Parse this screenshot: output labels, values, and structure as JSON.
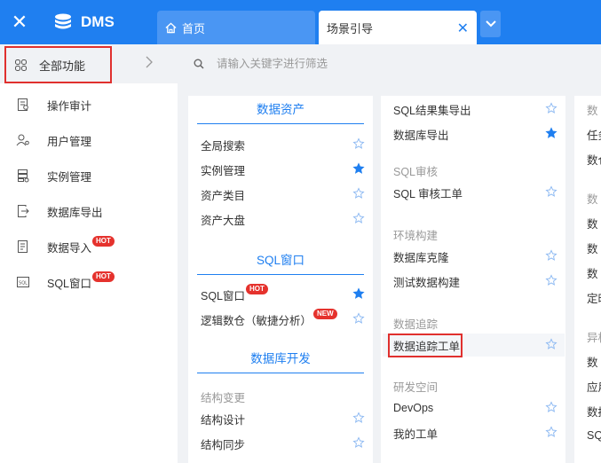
{
  "header": {
    "app_name": "DMS",
    "close_symbol": "✕",
    "tabs": [
      {
        "label": "首页"
      },
      {
        "label": "场景引导",
        "close_symbol": "✕"
      }
    ]
  },
  "sidebar": {
    "all_functions": "全部功能",
    "items": [
      {
        "label": "操作审计",
        "icon": "audit-icon"
      },
      {
        "label": "用户管理",
        "icon": "user-icon"
      },
      {
        "label": "实例管理",
        "icon": "instance-icon"
      },
      {
        "label": "数据库导出",
        "icon": "export-icon"
      },
      {
        "label": "数据导入",
        "icon": "import-icon",
        "badge": "HOT"
      },
      {
        "label": "SQL窗口",
        "icon": "sql-icon",
        "badge": "HOT"
      }
    ]
  },
  "search": {
    "placeholder": "请输入关键字进行筛选"
  },
  "columns": {
    "col1": {
      "sections": [
        {
          "title": "数据资产",
          "items": [
            {
              "label": "全局搜索",
              "starred": false
            },
            {
              "label": "实例管理",
              "starred": true
            },
            {
              "label": "资产类目",
              "starred": false
            },
            {
              "label": "资产大盘",
              "starred": false
            }
          ]
        },
        {
          "title": "SQL窗口",
          "items": [
            {
              "label": "SQL窗口",
              "badge": "HOT",
              "starred": true
            },
            {
              "label": "逻辑数仓（敏捷分析）",
              "badge": "NEW",
              "starred": false
            }
          ]
        },
        {
          "title": "数据库开发",
          "subgroup": "结构变更",
          "items": [
            {
              "label": "结构设计",
              "starred": false
            },
            {
              "label": "结构同步",
              "starred": false
            }
          ]
        }
      ]
    },
    "col2": {
      "groups": [
        {
          "title": "",
          "items": [
            {
              "label": "SQL结果集导出",
              "starred": false
            },
            {
              "label": "数据库导出",
              "starred": true
            }
          ]
        },
        {
          "title": "SQL审核",
          "items": [
            {
              "label": "SQL 审核工单",
              "starred": false
            }
          ]
        },
        {
          "title": "环境构建",
          "items": [
            {
              "label": "数据库克隆",
              "starred": false
            },
            {
              "label": "测试数据构建",
              "starred": false
            }
          ]
        },
        {
          "title": "数据追踪",
          "items": [
            {
              "label": "数据追踪工单",
              "starred": false
            }
          ]
        },
        {
          "title": "研发空间",
          "items": [
            {
              "label": "DevOps",
              "starred": false
            },
            {
              "label": "我的工单",
              "starred": false
            }
          ]
        }
      ]
    },
    "col3": {
      "fragments": [
        "数",
        "任务",
        "数仓",
        "数",
        "数",
        "数",
        "数",
        "定时",
        "异构",
        "数",
        "应用",
        "数据",
        "SQ"
      ]
    }
  },
  "colors": {
    "primary": "#1f7ff0",
    "highlight": "#e0302e",
    "badge": "#e5322d"
  }
}
